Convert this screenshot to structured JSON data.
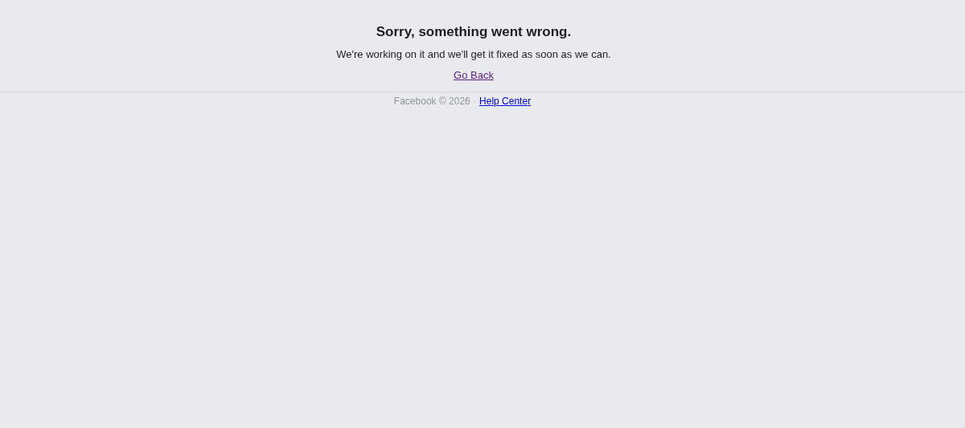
{
  "error": {
    "title": "Sorry, something went wrong.",
    "message": "We're working on it and we'll get it fixed as soon as we can.",
    "link": "Go Back"
  },
  "footer": {
    "text": "Facebook © 2026 ·",
    "link": "Help Center"
  }
}
